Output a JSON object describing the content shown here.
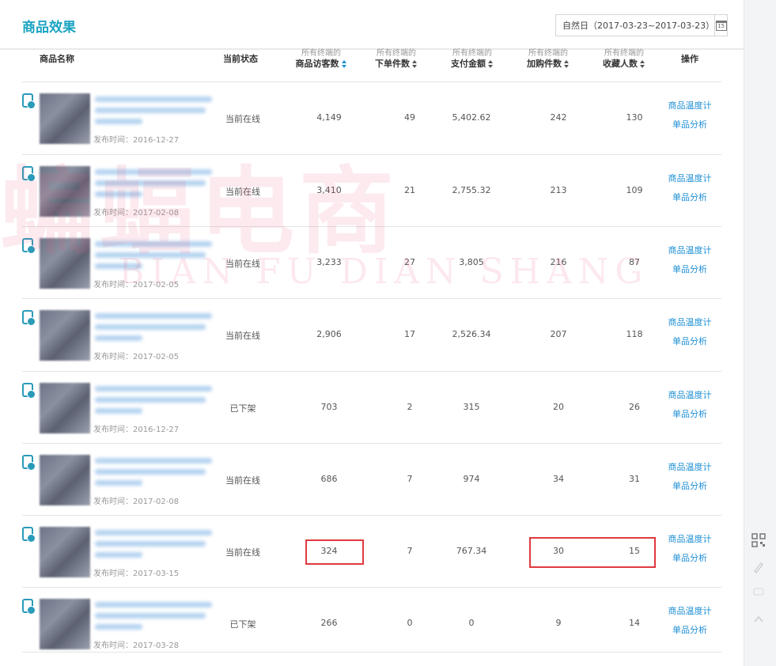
{
  "page": {
    "title": "商品效果"
  },
  "date_range": {
    "label": "自然日（2017-03-23~2017-03-23）",
    "calendar_icon_text": "15"
  },
  "columns": {
    "name": "商品名称",
    "status": "当前状态",
    "visitors": {
      "sub": "所有终端的",
      "main": "商品访客数"
    },
    "orders": {
      "sub": "所有终端的",
      "main": "下单件数"
    },
    "amount": {
      "sub": "所有终端的",
      "main": "支付金额"
    },
    "cart": {
      "sub": "所有终端的",
      "main": "加购件数"
    },
    "fav": {
      "sub": "所有终端的",
      "main": "收藏人数"
    },
    "action": "操作"
  },
  "rows": [
    {
      "published": "发布时间：2016-12-27",
      "status": "当前在线",
      "visitors": "4,149",
      "orders": "49",
      "amount": "5,402.62",
      "cart": "242",
      "fav": "130",
      "op1": "商品温度计",
      "op2": "单品分析"
    },
    {
      "published": "发布时间：2017-02-08",
      "status": "当前在线",
      "visitors": "3,410",
      "orders": "21",
      "amount": "2,755.32",
      "cart": "213",
      "fav": "109",
      "op1": "商品温度计",
      "op2": "单品分析"
    },
    {
      "published": "发布时间：2017-02-05",
      "status": "当前在线",
      "visitors": "3,233",
      "orders": "27",
      "amount": "3,805",
      "cart": "216",
      "fav": "87",
      "op1": "商品温度计",
      "op2": "单品分析"
    },
    {
      "published": "发布时间：2017-02-05",
      "status": "当前在线",
      "visitors": "2,906",
      "orders": "17",
      "amount": "2,526.34",
      "cart": "207",
      "fav": "118",
      "op1": "商品温度计",
      "op2": "单品分析"
    },
    {
      "published": "发布时间：2016-12-27",
      "status": "已下架",
      "visitors": "703",
      "orders": "2",
      "amount": "315",
      "cart": "20",
      "fav": "26",
      "op1": "商品温度计",
      "op2": "单品分析"
    },
    {
      "published": "发布时间：2017-02-08",
      "status": "当前在线",
      "visitors": "686",
      "orders": "7",
      "amount": "974",
      "cart": "34",
      "fav": "31",
      "op1": "商品温度计",
      "op2": "单品分析"
    },
    {
      "published": "发布时间：2017-03-15",
      "status": "当前在线",
      "visitors": "324",
      "orders": "7",
      "amount": "767.34",
      "cart": "30",
      "fav": "15",
      "op1": "商品温度计",
      "op2": "单品分析"
    },
    {
      "published": "发布时间：2017-03-28",
      "status": "已下架",
      "visitors": "266",
      "orders": "0",
      "amount": "0",
      "cart": "9",
      "fav": "14",
      "op1": "商品温度计",
      "op2": "单品分析"
    }
  ],
  "watermark": {
    "cn": "蝙蝠电商",
    "en": "BIAN FU DIAN SHANG"
  },
  "colors": {
    "accent": "#1aa3c2",
    "link": "#1e8fd4",
    "highlight": "#e0393f"
  }
}
